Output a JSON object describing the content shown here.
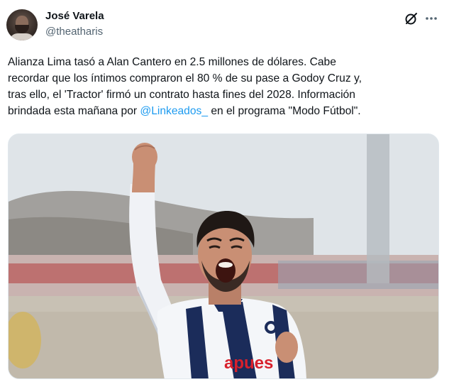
{
  "author": {
    "name": "José Varela",
    "handle": "@theatharis",
    "avatar_icon": "avatar-photo"
  },
  "header": {
    "grok_icon": "grok-icon",
    "more_icon": "more-options-icon"
  },
  "tweet": {
    "lines": [
      "Alianza Lima tasó a Alan Cantero en 2.5 millones de dólares. Cabe",
      "recordar que los íntimos compraron el 80 % de su pase a Godoy Cruz y,",
      "tras ello, el 'Tractor' firmó un contrato hasta fines del 2028. Información"
    ],
    "last_line_prefix": "brindada esta mañana por ",
    "mention": "@Linkeados_",
    "last_line_suffix": " en el programa \"Modo Fútbol\"."
  },
  "media": {
    "jersey_text": "apues",
    "colors": {
      "sky": "#dfe4e8",
      "jersey_blue": "#1b2c5a",
      "jersey_white": "#f4f6f9",
      "skin": "#c98f74",
      "sponsor_red": "#d8202c",
      "stands_red": "#b23a3c"
    }
  },
  "colors": {
    "text": "#0f1419",
    "secondary": "#536471",
    "link": "#1d9bf0"
  }
}
